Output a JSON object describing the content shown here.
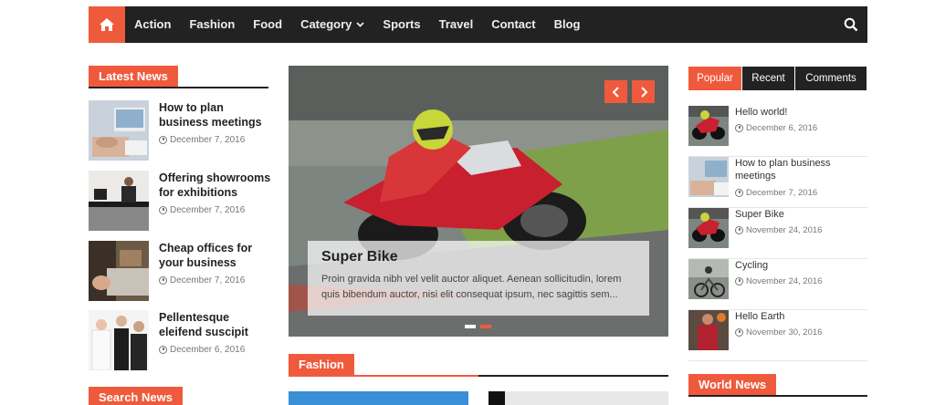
{
  "nav": {
    "home_icon": "home-icon",
    "items": [
      "Action",
      "Fashion",
      "Food",
      "Category",
      "Sports",
      "Travel",
      "Contact",
      "Blog"
    ],
    "search_icon": "search-icon"
  },
  "colors": {
    "accent": "#f05a3c",
    "dark": "#222222"
  },
  "latest_news": {
    "heading": "Latest News",
    "items": [
      {
        "title": "How to plan business meetings",
        "date": "December 7, 2016"
      },
      {
        "title": "Offering showrooms for exhibitions",
        "date": "December 7, 2016"
      },
      {
        "title": "Cheap offices for your business",
        "date": "December 7, 2016"
      },
      {
        "title": "Pellentesque eleifend suscipit",
        "date": "December 6, 2016"
      }
    ]
  },
  "search_news": {
    "heading": "Search News"
  },
  "slider": {
    "title": "Super Bike",
    "text": "Proin gravida nibh vel velit auctor aliquet. Aenean sollicitudin, lorem quis bibendum auctor, nisi elit consequat ipsum, nec sagittis sem...",
    "active_slide": 2,
    "slide_count": 2
  },
  "fashion": {
    "heading": "Fashion"
  },
  "tabs": {
    "items": [
      "Popular",
      "Recent",
      "Comments"
    ],
    "active": "Popular"
  },
  "popular": [
    {
      "title": "Hello world!",
      "date": "December 6, 2016"
    },
    {
      "title": "How to plan business meetings",
      "date": "December 7, 2016"
    },
    {
      "title": "Super Bike",
      "date": "November 24, 2016"
    },
    {
      "title": "Cycling",
      "date": "November 24, 2016"
    },
    {
      "title": "Hello Earth",
      "date": "November 30, 2016"
    }
  ],
  "world_news": {
    "heading": "World News"
  }
}
